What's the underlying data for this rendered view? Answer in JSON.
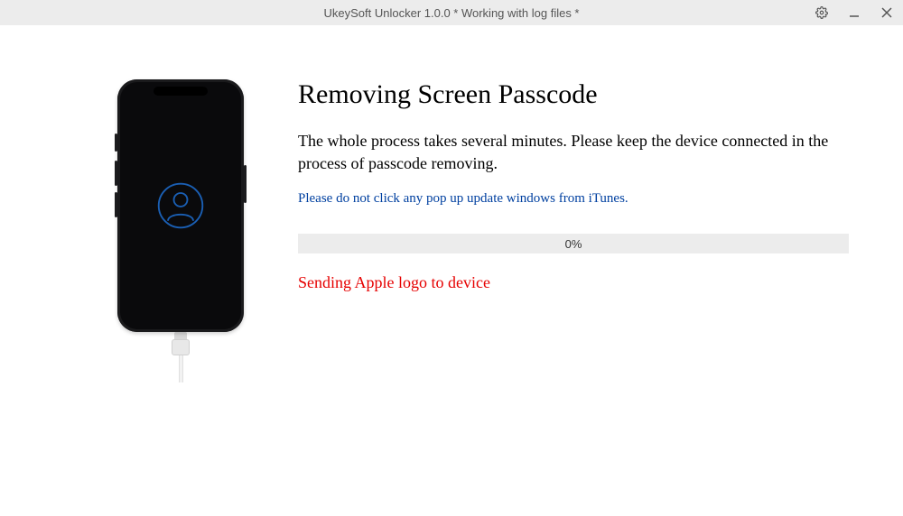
{
  "titlebar": {
    "title": "UkeySoft Unlocker 1.0.0 * Working with log files *"
  },
  "main": {
    "heading": "Removing Screen Passcode",
    "description": "The whole process takes several minutes. Please keep the device connected in the process of passcode removing.",
    "warning": "Please do not click any pop up update windows from iTunes.",
    "progress_percent": "0%",
    "status": "Sending Apple logo to device"
  }
}
